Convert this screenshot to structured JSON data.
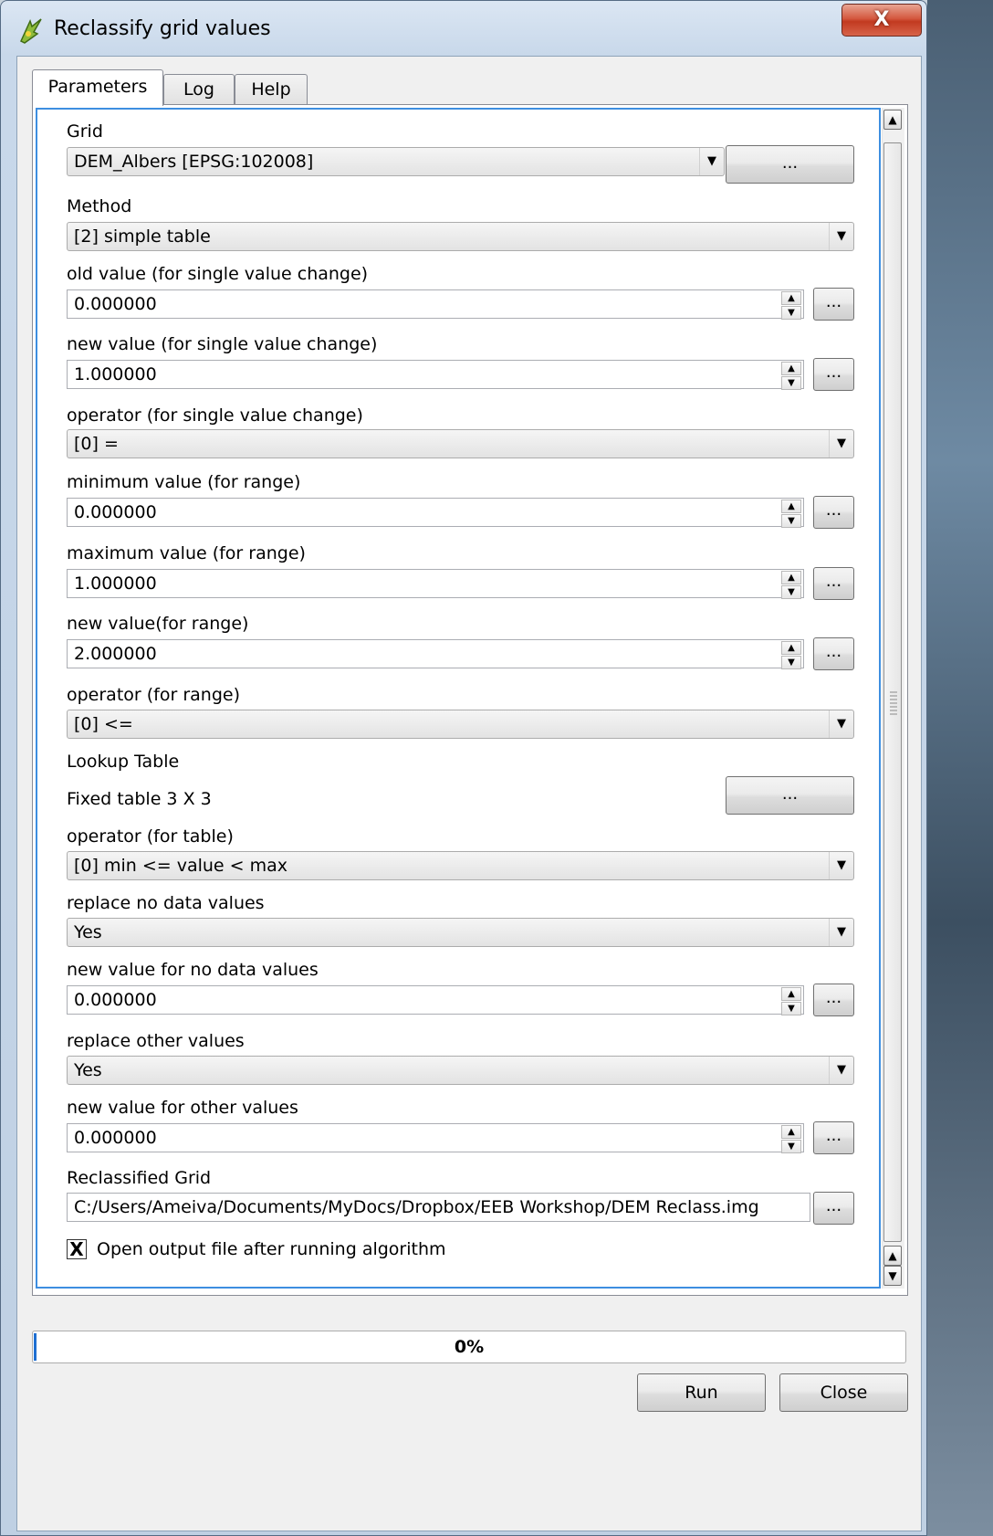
{
  "window": {
    "title": "Reclassify grid values",
    "close_glyph": "X"
  },
  "tabs": [
    {
      "label": "Parameters",
      "active": true
    },
    {
      "label": "Log",
      "active": false
    },
    {
      "label": "Help",
      "active": false
    }
  ],
  "form": {
    "grid": {
      "label": "Grid",
      "value": "DEM_Albers [EPSG:102008]",
      "button": "..."
    },
    "method": {
      "label": "Method",
      "value": "[2] simple table"
    },
    "old_value": {
      "label": "old value (for single value change)",
      "value": "0.000000",
      "button": "..."
    },
    "new_value": {
      "label": "new value (for single value change)",
      "value": "1.000000",
      "button": "..."
    },
    "operator_single": {
      "label": "operator (for single value change)",
      "value": "[0] ="
    },
    "min_range": {
      "label": "minimum value (for range)",
      "value": "0.000000",
      "button": "..."
    },
    "max_range": {
      "label": "maximum value (for range)",
      "value": "1.000000",
      "button": "..."
    },
    "new_range": {
      "label": "new value(for range)",
      "value": "2.000000",
      "button": "..."
    },
    "operator_range": {
      "label": "operator (for range)",
      "value": "[0] <="
    },
    "lookup": {
      "label": "Lookup Table",
      "text": "Fixed table 3 X 3",
      "button": "..."
    },
    "operator_table": {
      "label": "operator (for table)",
      "value": "[0] min <= value < max"
    },
    "replace_nodata": {
      "label": "replace no data values",
      "value": "Yes"
    },
    "nodata_value": {
      "label": "new value for no data values",
      "value": "0.000000",
      "button": "..."
    },
    "replace_other": {
      "label": "replace other values",
      "value": "Yes"
    },
    "other_value": {
      "label": "new value for other values",
      "value": "0.000000",
      "button": "..."
    },
    "output": {
      "label": "Reclassified Grid",
      "value": "C:/Users/Ameiva/Documents/MyDocs/Dropbox/EEB Workshop/DEM Reclass.img",
      "button": "..."
    },
    "open_output": {
      "label": "Open output file after running algorithm",
      "checked": true,
      "mark": "X"
    }
  },
  "progress": {
    "text": "0%",
    "value": 0
  },
  "buttons": {
    "run": "Run",
    "close": "Close"
  },
  "icons": {
    "combo_arrow": "▼",
    "spin_up": "▲",
    "spin_down": "▼",
    "scroll_up": "▲",
    "scroll_down": "▼"
  }
}
